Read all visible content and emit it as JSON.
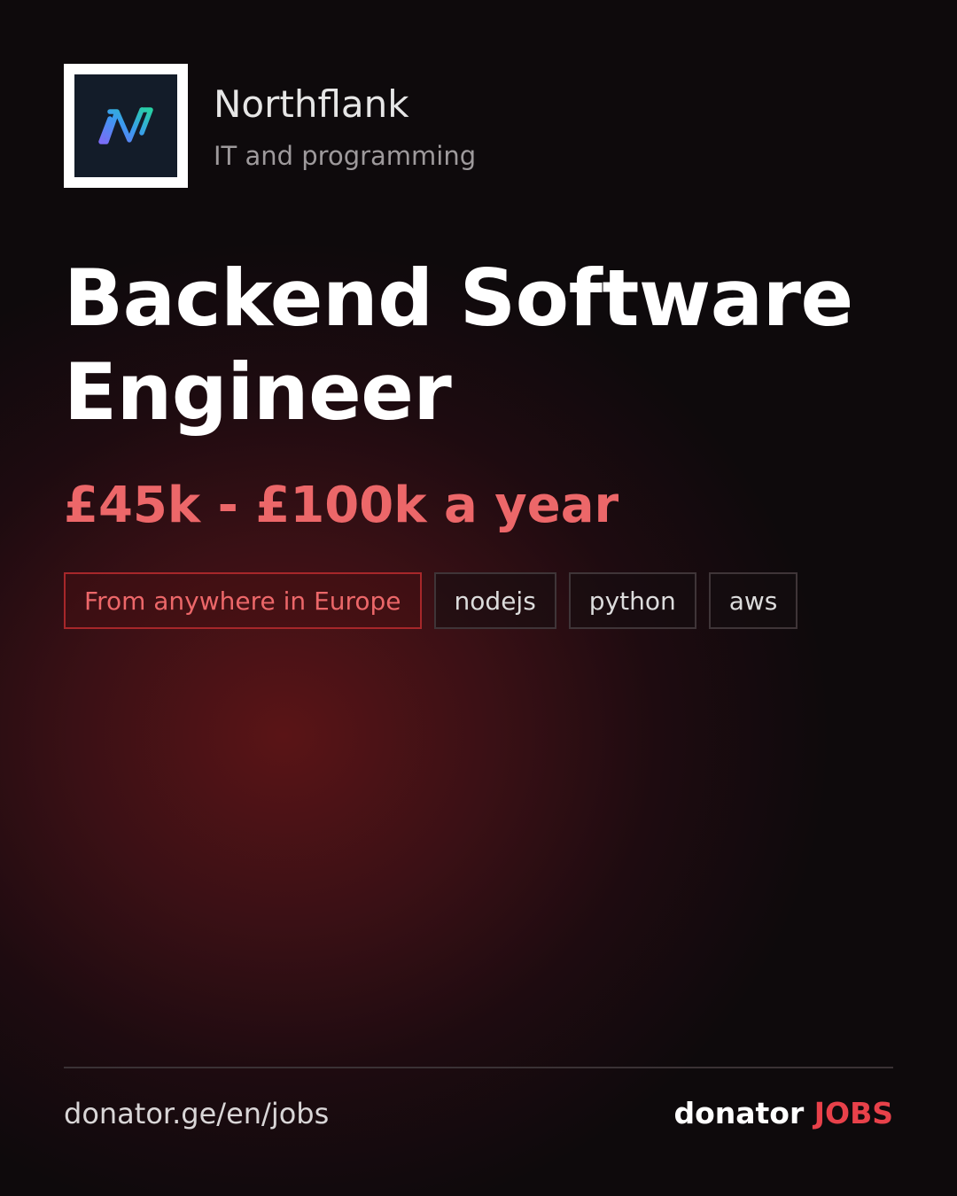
{
  "company": {
    "name": "Northflank",
    "category": "IT and programming",
    "logo_icon": "northflank-logo-icon"
  },
  "job": {
    "title": "Backend Software Engineer",
    "salary": "£45k - £100k a year"
  },
  "tags": {
    "location": "From anywhere in Europe",
    "skills": [
      "nodejs",
      "python",
      "aws"
    ]
  },
  "footer": {
    "url": "donator.ge/en/jobs",
    "brand_main": "donator",
    "brand_accent": "JOBS"
  },
  "colors": {
    "accent": "#ec6769",
    "brand_accent": "#e8414a",
    "background": "#0e0a0c",
    "logo_background": "#131c29"
  }
}
